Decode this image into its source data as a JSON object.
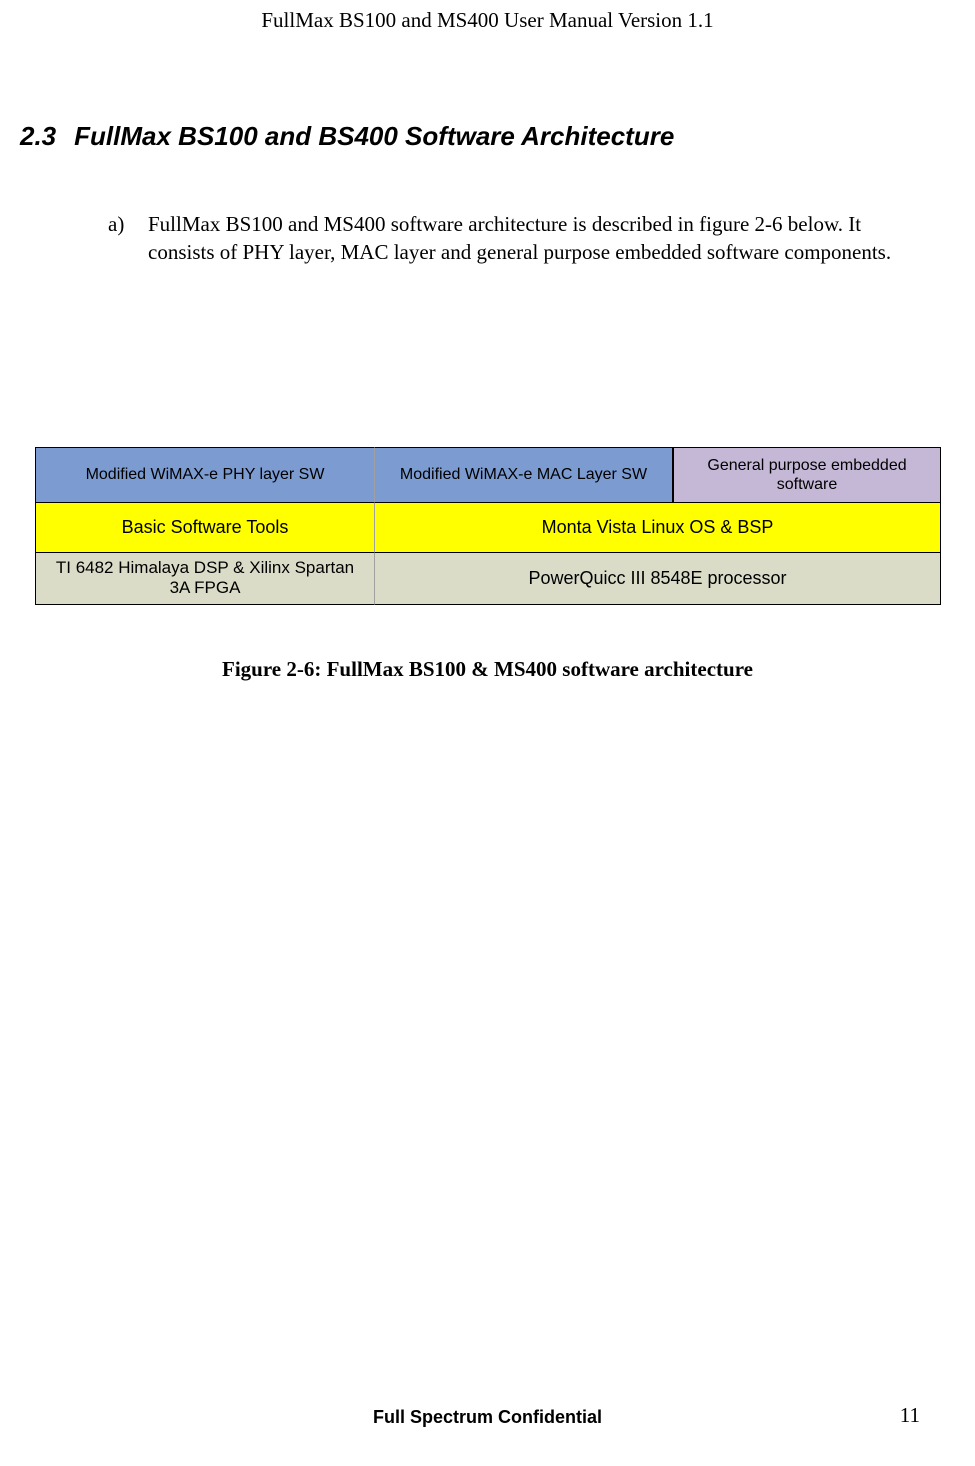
{
  "header": {
    "title": "FullMax BS100 and MS400 User Manual Version 1.1"
  },
  "section": {
    "number": "2.3",
    "title": "FullMax BS100 and BS400 Software Architecture"
  },
  "body": {
    "list_marker": "a)",
    "paragraph": "FullMax BS100 and MS400 software architecture is described in figure 2-6 below. It consists of PHY layer, MAC layer and general purpose embedded software components."
  },
  "diagram": {
    "row1": {
      "c1": "Modified  WiMAX-e  PHY layer SW",
      "c2": "Modified WiMAX-e MAC Layer  SW",
      "c3": "General purpose embedded software"
    },
    "row2": {
      "c1": "Basic Software Tools",
      "c2": "Monta Vista Linux OS & BSP"
    },
    "row3": {
      "c1": "TI  6482 Himalaya DSP & Xilinx Spartan 3A FPGA",
      "c2": "PowerQuicc III 8548E processor"
    }
  },
  "figure_caption": "Figure 2-6: FullMax BS100 & MS400 software architecture",
  "footer": {
    "confidential": "Full Spectrum Confidential",
    "page_number": "11"
  }
}
